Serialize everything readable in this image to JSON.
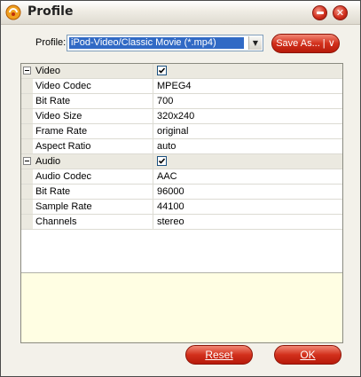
{
  "window": {
    "title": "Profile"
  },
  "profile": {
    "label": "Profile:",
    "selected": "iPod-Video/Classic Movie (*.mp4)",
    "save_as_label": "Save As...  | ∨"
  },
  "video": {
    "section_label": "Video",
    "enabled": true,
    "rows": [
      {
        "key": "Video Codec",
        "value": "MPEG4"
      },
      {
        "key": "Bit Rate",
        "value": "700"
      },
      {
        "key": "Video Size",
        "value": "320x240"
      },
      {
        "key": "Frame Rate",
        "value": "original"
      },
      {
        "key": "Aspect Ratio",
        "value": "auto"
      }
    ]
  },
  "audio": {
    "section_label": "Audio",
    "enabled": true,
    "rows": [
      {
        "key": "Audio Codec",
        "value": "AAC"
      },
      {
        "key": "Bit Rate",
        "value": "96000"
      },
      {
        "key": "Sample Rate",
        "value": "44100"
      },
      {
        "key": "Channels",
        "value": "stereo"
      }
    ]
  },
  "buttons": {
    "reset": "Reset",
    "ok": "OK"
  },
  "colors": {
    "accent": "#d2301c",
    "selection": "#316ac5",
    "description_bg": "#fffee3"
  }
}
